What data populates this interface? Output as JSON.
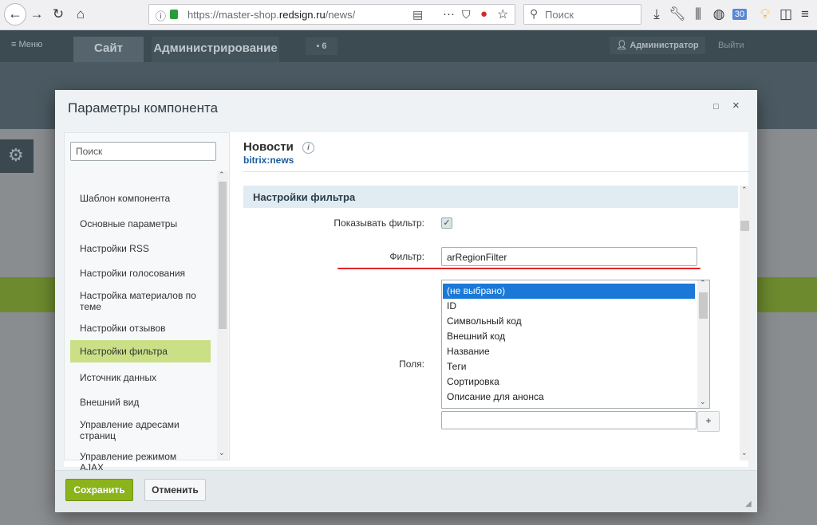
{
  "browser": {
    "url_prefix": "https://master-shop.",
    "url_domain": "redsign.ru",
    "url_path": "/news/",
    "search_placeholder": "Поиск",
    "badge_count": "30"
  },
  "admin_panel": {
    "menu_label": "Меню",
    "tab_site": "Сайт",
    "tab_admin": "Администрирование",
    "notifications_count": "6",
    "user_label": "Администратор",
    "logout_label": "Выйти"
  },
  "dialog": {
    "title": "Параметры компонента",
    "search_placeholder": "Поиск",
    "sidebar_items": [
      "Шаблон компонента",
      "Основные параметры",
      "Настройки RSS",
      "Настройки голосования",
      "Настройка материалов по теме",
      "Настройки отзывов",
      "Настройки фильтра",
      "Источник данных",
      "Внешний вид",
      "Управление адресами страниц",
      "Управление режимом AJAX"
    ],
    "component_title": "Новости",
    "component_id": "bitrix:news",
    "section_title": "Настройки фильтра",
    "show_filter_label": "Показывать фильтр:",
    "filter_label": "Фильтр:",
    "filter_value": "arRegionFilter",
    "fields_label": "Поля:",
    "field_options": [
      "(не выбрано)",
      "ID",
      "Символьный код",
      "Внешний код",
      "Название",
      "Теги",
      "Сортировка",
      "Описание для анонса"
    ],
    "add_button": "+",
    "save_button": "Сохранить",
    "cancel_button": "Отменить"
  }
}
